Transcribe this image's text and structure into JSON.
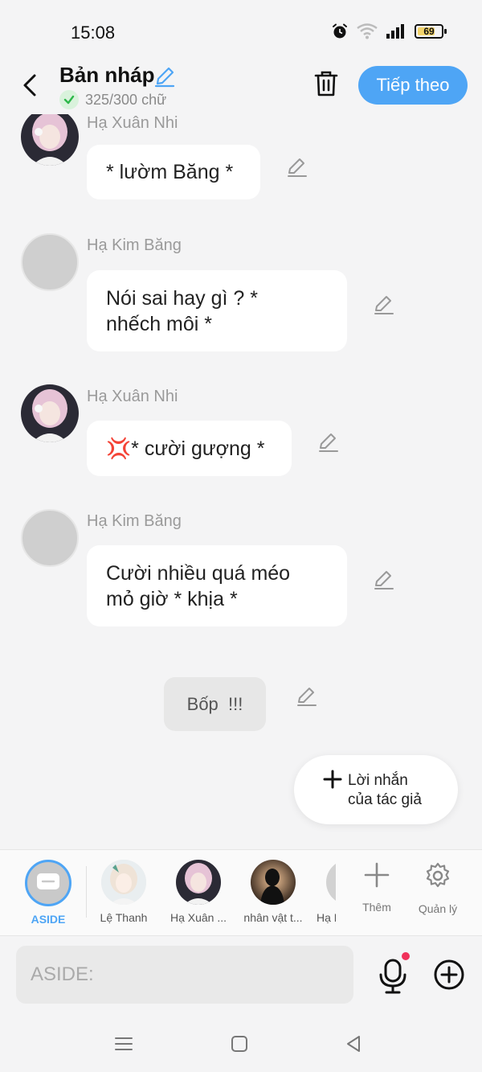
{
  "status_bar": {
    "time": "15:08",
    "battery": "69"
  },
  "header": {
    "title": "Bản nháp",
    "word_count": "325/300 chữ",
    "next_label": "Tiếp theo"
  },
  "messages": [
    {
      "name": "Hạ Xuân Nhi",
      "text": "* lườm Băng *"
    },
    {
      "name": "Hạ Kim Băng",
      "text_line1": "Nói sai hay gì ? *",
      "text_line2": "nhếch môi *"
    },
    {
      "name": "Hạ Xuân Nhi",
      "emoji": "💢",
      "text": "* cười gượng *"
    },
    {
      "name": "Hạ Kim Băng",
      "text_line1": "Cười nhiều quá méo",
      "text_line2": "mỏ giờ * khịa *"
    }
  ],
  "narration": {
    "text": "Bốp  !!!"
  },
  "author_note": {
    "line1": "Lời nhắn",
    "line2": "của tác giả"
  },
  "characters": [
    {
      "label": "ASIDE"
    },
    {
      "label": "Lệ Thanh"
    },
    {
      "label": "Hạ Xuân ..."
    },
    {
      "label": "nhân vật t..."
    },
    {
      "label": "Hạ K"
    }
  ],
  "tools": {
    "add_label": "Thêm",
    "manage_label": "Quản lý"
  },
  "input": {
    "placeholder": "ASIDE:"
  },
  "colors": {
    "accent": "#4ea5f5",
    "bubble": "#ffffff",
    "background": "#f4f4f5",
    "notification": "#f0315a"
  }
}
